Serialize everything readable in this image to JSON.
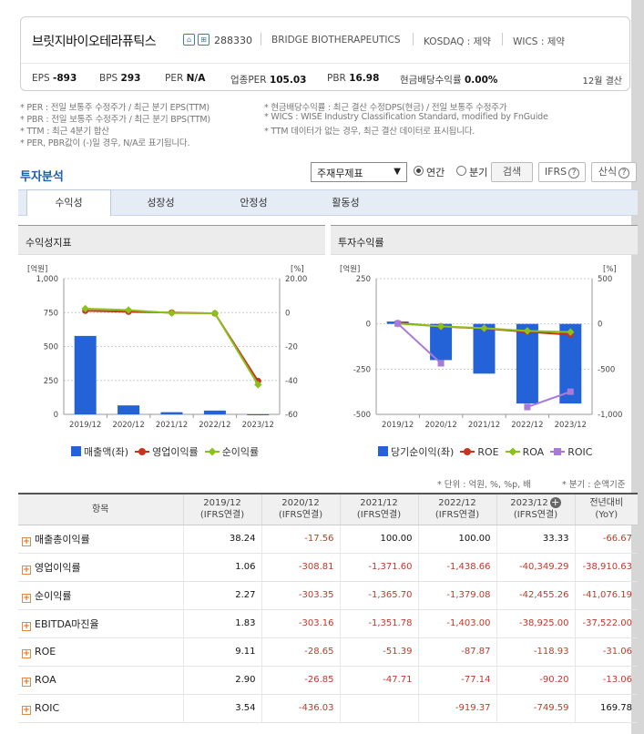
{
  "company": {
    "name": "브릿지바이오테라퓨틱스",
    "badge1": "⌂",
    "badge2": "⊞",
    "code": "288330",
    "english_name": "BRIDGE BIOTHERAPEUTICS",
    "market": "KOSDAQ : 제약",
    "wics": "WICS : 제약",
    "metrics": [
      {
        "label": "EPS",
        "value": "-893"
      },
      {
        "label": "BPS",
        "value": "293"
      },
      {
        "label": "PER",
        "value": "N/A"
      },
      {
        "label": "업종PER",
        "value": "105.03"
      },
      {
        "label": "PBR",
        "value": "16.98"
      },
      {
        "label": "현금배당수익률",
        "value": "0.00%"
      }
    ],
    "settlement": "12월 결산"
  },
  "notes": {
    "left": [
      "* PER : 전일 보통주 수정주가 / 최근 분기 EPS(TTM)",
      "* PBR : 전일 보통주 수정주가 / 최근 분기 BPS(TTM)",
      "* TTM : 최근 4분기 합산",
      "* PER, PBR값이 (-)일 경우, N/A로 표기됩니다."
    ],
    "right": [
      "* 현금배당수익률 : 최근 결산 수정DPS(현금) / 전일 보통주 수정주가",
      "* WICS : WISE Industry Classification Standard, modified by FnGuide",
      "* TTM 데이터가 없는 경우, 최근 결산 데이터로 표시됩니다."
    ]
  },
  "analysis": {
    "title": "투자분석",
    "select_value": "주재무제표",
    "radio_annual": "연간",
    "radio_quarter": "분기",
    "search_button": "검색",
    "ifrs_button": "IFRS",
    "formula_button": "산식",
    "tabs": [
      "수익성",
      "성장성",
      "안정성",
      "활동성"
    ]
  },
  "chart_data": [
    {
      "type": "bar",
      "title": "수익성지표",
      "categories": [
        "2019/12",
        "2020/12",
        "2021/12",
        "2022/12",
        "2023/12"
      ],
      "left_unit": "[억원]",
      "right_unit": "[%]",
      "ylim_left": [
        0,
        1000
      ],
      "yticks_left": [
        "1,000",
        "750",
        "500",
        "250",
        "0"
      ],
      "ylim_right": [
        -60,
        20
      ],
      "yticks_right": [
        "20.00",
        "0",
        "-20",
        "-40",
        "-60"
      ],
      "series": [
        {
          "name": "매출액(좌)",
          "kind": "bar",
          "axis": "left",
          "values": [
            578,
            66,
            16,
            28,
            0
          ]
        },
        {
          "name": "영업이익률",
          "kind": "line",
          "axis": "right",
          "values": [
            1.06,
            0.5,
            0,
            -0.5,
            -40.35
          ]
        },
        {
          "name": "순이익률",
          "kind": "line",
          "axis": "right",
          "values": [
            2.27,
            1.5,
            -0.3,
            -0.4,
            -42.46
          ]
        }
      ],
      "colors": {
        "bar": "#2462d8",
        "op": "#c8321e",
        "net": "#8ac21c"
      }
    },
    {
      "type": "bar",
      "title": "투자수익률",
      "categories": [
        "2019/12",
        "2020/12",
        "2021/12",
        "2022/12",
        "2023/12"
      ],
      "left_unit": "[억원]",
      "right_unit": "[%]",
      "ylim_left": [
        -500,
        250
      ],
      "yticks_left": [
        "250",
        "0",
        "-250",
        "-500"
      ],
      "ylim_right": [
        -1000,
        500
      ],
      "yticks_right": [
        "500",
        "0",
        "-500",
        "-1,000"
      ],
      "series": [
        {
          "name": "당기순이익(좌)",
          "kind": "bar",
          "axis": "left",
          "values": [
            13,
            -200,
            -275,
            -440,
            -440
          ]
        },
        {
          "name": "ROE",
          "kind": "line",
          "axis": "right",
          "values": [
            9.11,
            -28.65,
            -51.39,
            -87.87,
            -118.93
          ]
        },
        {
          "name": "ROA",
          "kind": "line",
          "axis": "right",
          "values": [
            2.9,
            -26.85,
            -47.71,
            -77.14,
            -90.2
          ]
        },
        {
          "name": "ROIC",
          "kind": "line",
          "axis": "right",
          "values": [
            3.54,
            -436.03,
            null,
            -919.37,
            -749.59
          ]
        }
      ],
      "colors": {
        "bar": "#2462d8",
        "roe": "#c8321e",
        "roa": "#8ac21c",
        "roic": "#a97ad8"
      }
    }
  ],
  "units_note": "* 단위 : 억원, %, %p, 배",
  "quarter_note": "* 분기 : 순액기준",
  "table": {
    "header_item": "항목",
    "columns": [
      {
        "year": "2019/12",
        "basis": "(IFRS연결)"
      },
      {
        "year": "2020/12",
        "basis": "(IFRS연결)"
      },
      {
        "year": "2021/12",
        "basis": "(IFRS연결)"
      },
      {
        "year": "2022/12",
        "basis": "(IFRS연결)"
      },
      {
        "year": "2023/12",
        "basis": "(IFRS연결)"
      },
      {
        "year": "전년대비",
        "basis": "(YoY)"
      }
    ],
    "rows": [
      {
        "name": "매출총이익률",
        "values": [
          "38.24",
          "-17.56",
          "100.00",
          "100.00",
          "33.33",
          "-66.67"
        ]
      },
      {
        "name": "영업이익률",
        "values": [
          "1.06",
          "-308.81",
          "-1,371.60",
          "-1,438.66",
          "-40,349.29",
          "-38,910.63"
        ]
      },
      {
        "name": "순이익률",
        "values": [
          "2.27",
          "-303.35",
          "-1,365.70",
          "-1,379.08",
          "-42,455.26",
          "-41,076.19"
        ]
      },
      {
        "name": "EBITDA마진율",
        "values": [
          "1.83",
          "-303.16",
          "-1,351.78",
          "-1,403.00",
          "-38,925.00",
          "-37,522.00"
        ]
      },
      {
        "name": "ROE",
        "values": [
          "9.11",
          "-28.65",
          "-51.39",
          "-87.87",
          "-118.93",
          "-31.06"
        ]
      },
      {
        "name": "ROA",
        "values": [
          "2.90",
          "-26.85",
          "-47.71",
          "-77.14",
          "-90.20",
          "-13.06"
        ]
      },
      {
        "name": "ROIC",
        "values": [
          "3.54",
          "-436.03",
          "",
          "-919.37",
          "-749.59",
          "169.78"
        ]
      }
    ]
  }
}
